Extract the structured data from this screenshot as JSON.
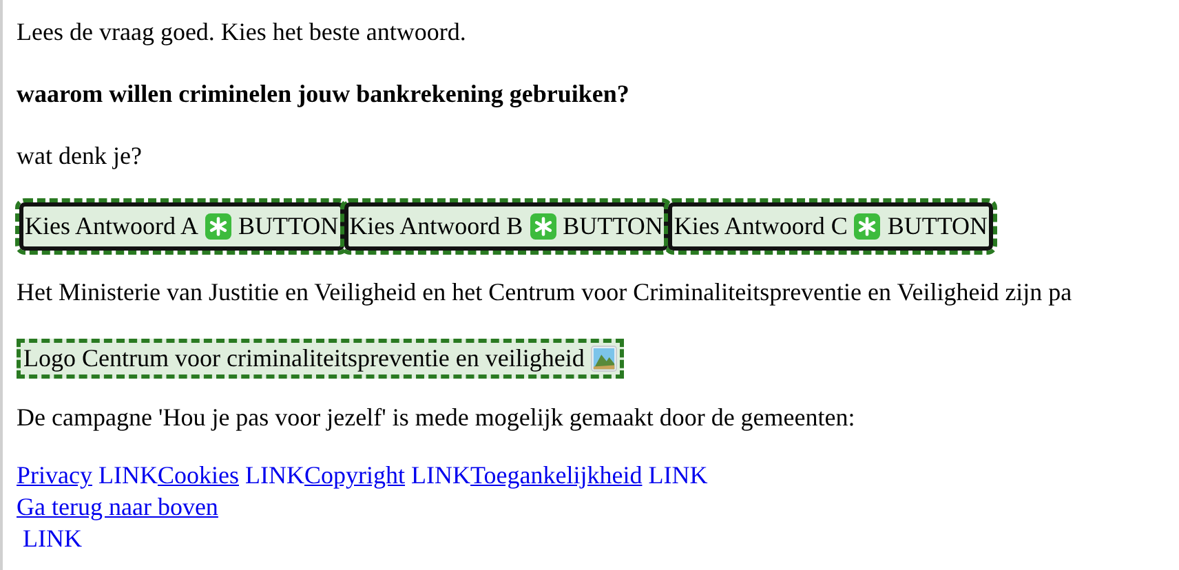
{
  "instruction": "Lees de vraag goed. Kies het beste antwoord.",
  "question": "waarom willen criminelen jouw bankrekening gebruiken?",
  "prompt": "wat denk je?",
  "answer_buttons": [
    {
      "label": "Kies Antwoord A",
      "suffix": "BUTTON"
    },
    {
      "label": "Kies Antwoord B",
      "suffix": "BUTTON"
    },
    {
      "label": "Kies Antwoord C",
      "suffix": "BUTTON"
    }
  ],
  "sponsor_text": "Het Ministerie van Justitie en Veiligheid en het Centrum voor Criminaliteitspreventie en Veiligheid zijn pa",
  "logo": {
    "alt": "Logo Centrum voor criminaliteitspreventie en veiligheid"
  },
  "campaign_text": "De campagne 'Hou je pas voor jezelf' is mede mogelijk gemaakt door de gemeenten:",
  "footer_links": [
    {
      "label": "Privacy",
      "suffix": "LINK"
    },
    {
      "label": "Cookies",
      "suffix": "LINK"
    },
    {
      "label": "Copyright",
      "suffix": "LINK"
    },
    {
      "label": "Toegankelijkheid",
      "suffix": "LINK"
    }
  ],
  "back_to_top": {
    "label": "Ga terug naar boven",
    "suffix": "LINK"
  }
}
